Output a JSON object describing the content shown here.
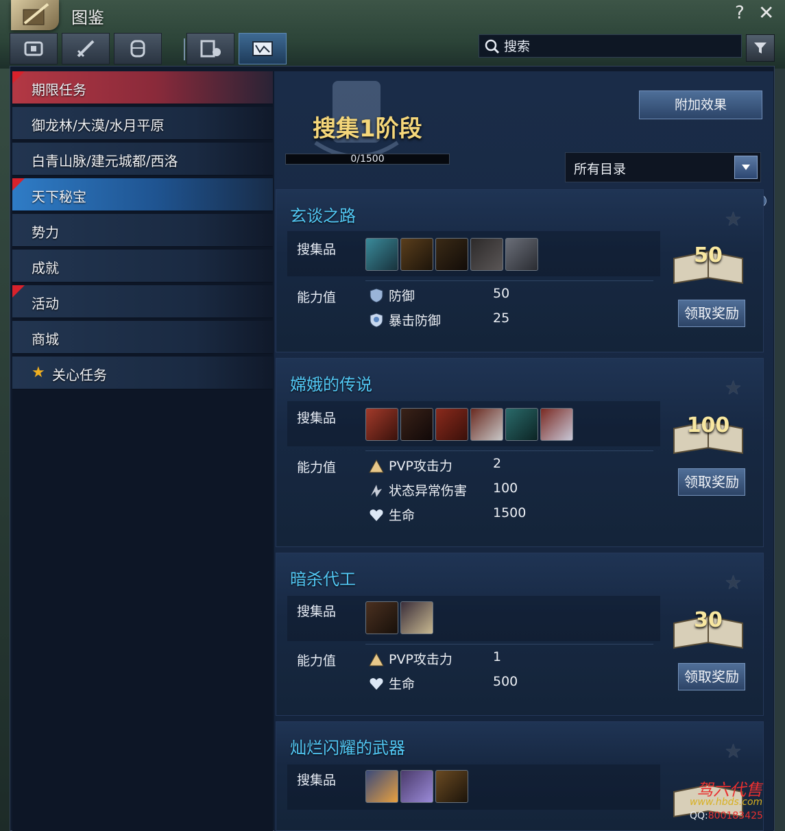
{
  "window": {
    "title": "图鉴",
    "help": "?",
    "close": "✕"
  },
  "tabs": [
    {
      "icon": "chest-icon",
      "active": false
    },
    {
      "icon": "sword-icon",
      "active": false
    },
    {
      "icon": "armor-icon",
      "active": false
    },
    {
      "icon": "map-icon",
      "active": false
    },
    {
      "icon": "scroll-map-icon",
      "active": true
    }
  ],
  "search": {
    "placeholder": "搜索",
    "value": ""
  },
  "sidebar": {
    "items": [
      {
        "label": "期限任务",
        "state": "active-red",
        "flag": true
      },
      {
        "label": "御龙林/大漠/水月平原",
        "state": "",
        "flag": false
      },
      {
        "label": "白青山脉/建元城都/西洛",
        "state": "",
        "flag": false
      },
      {
        "label": "天下秘宝",
        "state": "active-blue",
        "flag": true
      },
      {
        "label": "势力",
        "state": "",
        "flag": false
      },
      {
        "label": "成就",
        "state": "",
        "flag": false
      },
      {
        "label": "活动",
        "state": "",
        "flag": true
      },
      {
        "label": "商城",
        "state": "",
        "flag": false
      },
      {
        "label": "关心任务",
        "state": "",
        "flag": false,
        "star": true
      }
    ]
  },
  "header": {
    "stage_title": "搜集1阶段",
    "progress_text": "0/1500",
    "progress_fraction": 0,
    "bonus_button": "附加效果",
    "category_select": "所有目录"
  },
  "labels": {
    "collect": "搜集品",
    "ability": "能力值",
    "claim": "领取奖励"
  },
  "cards": [
    {
      "name": "玄谈之路",
      "reward": "50",
      "items": [
        "#3a8a9a",
        "#5a3e1c",
        "#3a2a16",
        "#2d2a2a",
        "#6a6e78"
      ],
      "stats": [
        {
          "icon": "shield-icon",
          "name": "防御",
          "value": "50"
        },
        {
          "icon": "crit-defense-icon",
          "name": "暴击防御",
          "value": "25"
        }
      ]
    },
    {
      "name": "嫦娥的传说",
      "reward": "100",
      "items": [
        "#a23a2a",
        "#3a2218",
        "#8a2a1c",
        "#6a2a20",
        "#2a6a6a",
        "#7a2a22"
      ],
      "stats": [
        {
          "icon": "pvp-attack-icon",
          "name": "PVP攻击力",
          "value": "2"
        },
        {
          "icon": "status-damage-icon",
          "name": "状态异常伤害",
          "value": "100"
        },
        {
          "icon": "heart-icon",
          "name": "生命",
          "value": "1500"
        }
      ]
    },
    {
      "name": "暗杀代工",
      "reward": "30",
      "items": [
        "#4a3020",
        "#3a2e3a"
      ],
      "stats": [
        {
          "icon": "pvp-attack-icon",
          "name": "PVP攻击力",
          "value": "1"
        },
        {
          "icon": "heart-icon",
          "name": "生命",
          "value": "500"
        }
      ]
    },
    {
      "name": "灿烂闪耀的武器",
      "reward": "",
      "items": [
        "#3a4a7a",
        "#4a3a6a",
        "#6a4a22"
      ],
      "stats": []
    }
  ],
  "watermark": {
    "brand": "驾六代售",
    "url": "www.hbds.com",
    "qq_label": "QQ:",
    "qq_number": "800183425"
  }
}
